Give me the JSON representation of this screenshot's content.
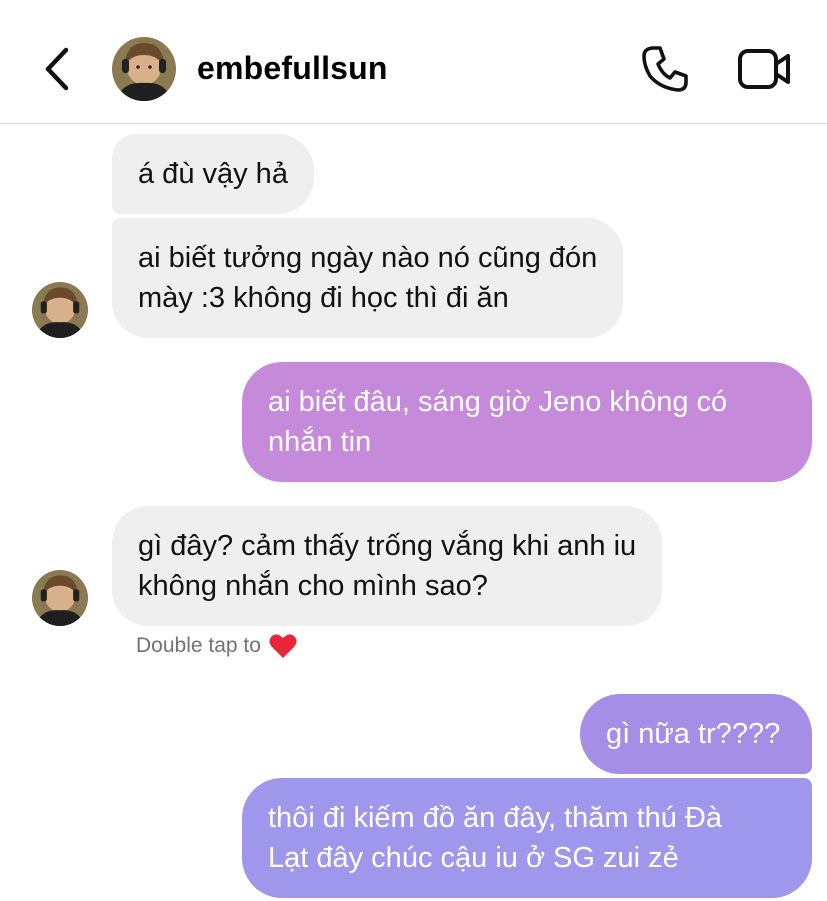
{
  "header": {
    "username": "embefullsun",
    "icons": {
      "back": "chevron-left-icon",
      "call": "phone-icon",
      "video": "video-camera-icon"
    }
  },
  "messages": [
    {
      "direction": "incoming",
      "text_lines": [
        "á đù vậy hả"
      ]
    },
    {
      "direction": "incoming",
      "text_lines": [
        "ai biết tưởng ngày nào nó cũng đón",
        "mày :3 không đi học thì đi ăn"
      ]
    },
    {
      "direction": "outgoing",
      "text_lines": [
        "ai biết đâu, sáng giờ Jeno không có",
        "nhắn tin"
      ]
    },
    {
      "direction": "incoming",
      "text_lines": [
        "gì đây? cảm thấy trống vắng khi anh iu",
        "không nhắn cho mình sao?"
      ]
    },
    {
      "direction": "outgoing",
      "text_lines": [
        "gì nữa tr????"
      ]
    },
    {
      "direction": "outgoing",
      "text_lines": [
        "thôi đi kiếm đồ ăn đây, thăm thú Đà",
        "Lạt đây chúc cậu iu ở SG zui zẻ"
      ]
    }
  ],
  "reaction_hint": {
    "text": "Double tap to",
    "icon": "heart-icon",
    "color": "#e8263a"
  },
  "colors": {
    "incoming_bubble": "#efefef",
    "outgoing_purple_1": "#c58ad9",
    "outgoing_purple_2": "#a58ee6",
    "outgoing_purple_3": "#9f97ec",
    "hint_text": "#737373"
  }
}
